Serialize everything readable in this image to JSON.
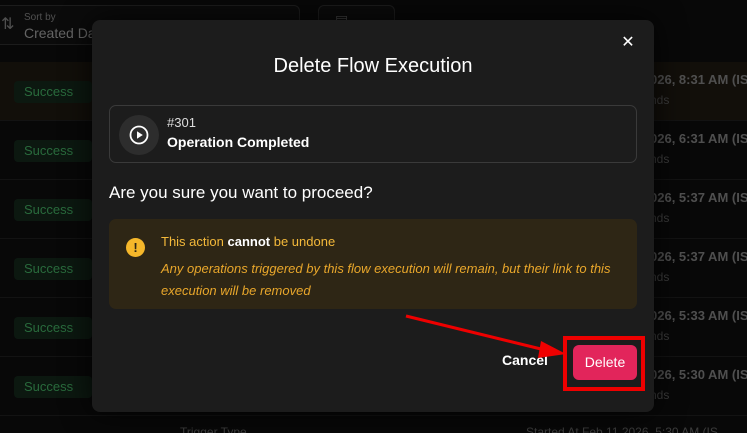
{
  "background": {
    "sort": {
      "caption": "Sort by",
      "value": "Created Da",
      "icon": "sort-icon"
    },
    "filter": {
      "icon": "filter-icon"
    },
    "rows": [
      {
        "status": "Success",
        "time": "026, 8:31 AM (IS",
        "duration": "nds"
      },
      {
        "status": "Success",
        "time": "026, 6:31 AM (IS",
        "duration": "nds"
      },
      {
        "status": "Success",
        "time": "026, 5:37 AM (IS",
        "duration": "nds"
      },
      {
        "status": "Success",
        "time": "026, 5:37 AM (IS",
        "duration": "nds"
      },
      {
        "status": "Success",
        "time": "026, 5:33 AM (IS",
        "duration": "nds"
      },
      {
        "status": "Success",
        "time": "026, 5:30 AM (IS",
        "duration": "nds"
      }
    ],
    "footer_left": "Trigger Type",
    "footer_right": "Started At Feb 11 2026, 5:30 AM (IS"
  },
  "modal": {
    "title": "Delete Flow Execution",
    "close_icon": "close-icon",
    "execution": {
      "icon": "play-circle-icon",
      "id": "#301",
      "name": "Operation Completed"
    },
    "question": "Are you sure you want to proceed?",
    "warning": {
      "icon": "warning-icon",
      "prefix": "This action ",
      "emphasis": "cannot",
      "suffix": " be undone",
      "detail": "Any operations triggered by this flow execution will remain, but their link to this execution will be removed"
    },
    "cancel_label": "Cancel",
    "delete_label": "Delete"
  },
  "colors": {
    "accent_delete": "#e2255b",
    "warning_bg": "#2e2615",
    "warning_text": "#f4b93a",
    "success_text": "#3fa35c",
    "annotation": "#ee0000"
  }
}
